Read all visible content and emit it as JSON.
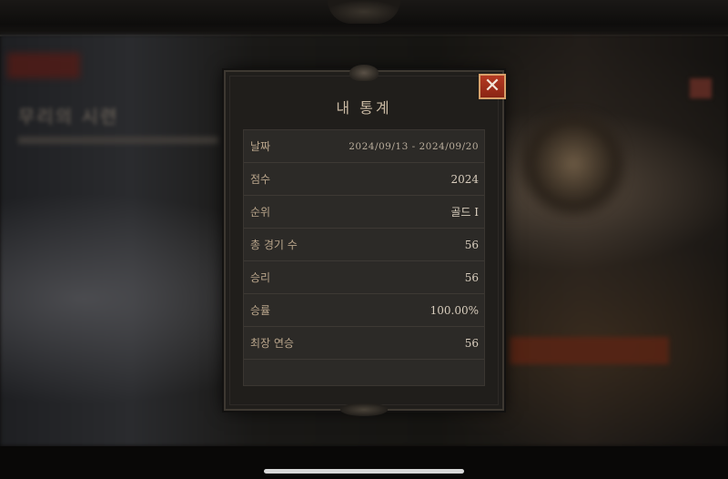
{
  "dialog": {
    "title": "내 통계",
    "close_label": "✕"
  },
  "background": {
    "left_title": "무리의 시련"
  },
  "stats": [
    {
      "label": "날짜",
      "value": "2024/09/13 - 2024/09/20"
    },
    {
      "label": "점수",
      "value": "2024"
    },
    {
      "label": "순위",
      "value": "골드 I"
    },
    {
      "label": "총 경기 수",
      "value": "56"
    },
    {
      "label": "승리",
      "value": "56"
    },
    {
      "label": "승률",
      "value": "100.00%"
    },
    {
      "label": "최장 연승",
      "value": "56"
    }
  ],
  "colors": {
    "close_button": "#b53a22",
    "label_text": "#b9a58b",
    "value_text": "#d8cdbd"
  }
}
